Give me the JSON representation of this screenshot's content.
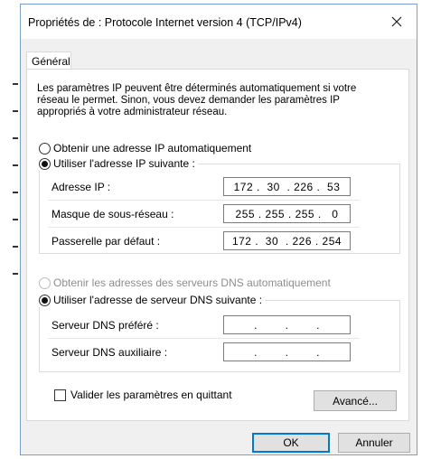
{
  "window": {
    "title": "Propriétés de : Protocole Internet version 4 (TCP/IPv4)"
  },
  "tabs": [
    {
      "label": "Général",
      "active": true
    }
  ],
  "description": "Les paramètres IP peuvent être déterminés automatiquement si votre réseau le permet. Sinon, vous devez demander les paramètres IP appropriés à votre administrateur réseau.",
  "ip_mode": {
    "auto_label": "Obtenir une adresse IP automatiquement",
    "manual_label": "Utiliser l'adresse IP suivante :",
    "selected": "manual"
  },
  "ip_fields": [
    {
      "label": "Adresse IP :",
      "value": "172 .  30  . 226 .  53"
    },
    {
      "label": "Masque de sous-réseau :",
      "value": "255 . 255 . 255 .   0"
    },
    {
      "label": "Passerelle par défaut :",
      "value": "172 .  30  . 226 . 254"
    }
  ],
  "dns_mode": {
    "auto_label": "Obtenir les adresses des serveurs DNS automatiquement",
    "manual_label": "Utiliser l'adresse de serveur DNS suivante :",
    "selected": "manual",
    "auto_disabled": true
  },
  "dns_fields": [
    {
      "label": "Serveur DNS préféré :",
      "value": ".        .        ."
    },
    {
      "label": "Serveur DNS auxiliaire :",
      "value": ".        .        ."
    }
  ],
  "validate_checkbox": {
    "label": "Valider les paramètres en quittant",
    "checked": false
  },
  "buttons": {
    "advanced": "Avancé...",
    "ok": "OK",
    "cancel": "Annuler"
  },
  "colors": {
    "accent": "#0078d7",
    "dialog_bg": "#f0f0f0",
    "disabled_text": "#8d8d8d"
  }
}
